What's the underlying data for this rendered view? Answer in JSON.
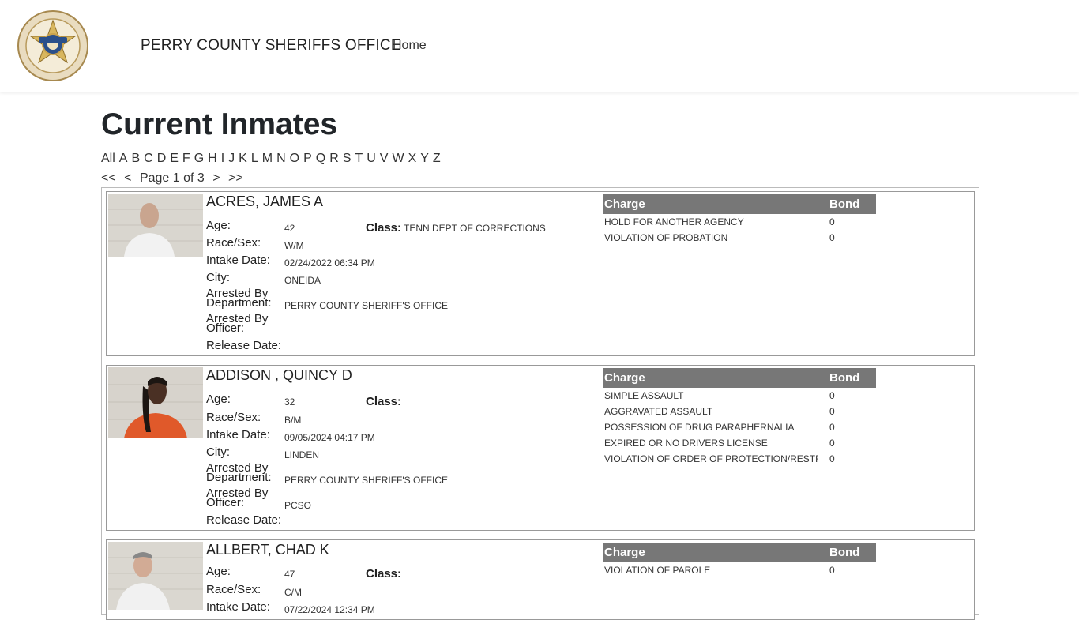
{
  "nav": {
    "brand": "PERRY COUNTY SHERIFFS OFFICE",
    "home": "Home"
  },
  "logo": {
    "top_text": "PERRY COUNTY",
    "bottom_text": "SHERIFFS OFFICE",
    "ribbon_text": "PROTECT"
  },
  "page_title": "Current Inmates",
  "alphabet": [
    "All",
    "A",
    "B",
    "C",
    "D",
    "E",
    "F",
    "G",
    "H",
    "I",
    "J",
    "K",
    "L",
    "M",
    "N",
    "O",
    "P",
    "Q",
    "R",
    "S",
    "T",
    "U",
    "V",
    "W",
    "X",
    "Y",
    "Z"
  ],
  "pager": {
    "first": "<<",
    "prev": "<",
    "label": "Page 1 of 3",
    "next": ">",
    "last": ">>"
  },
  "labels": {
    "age": "Age:",
    "race_sex": "Race/Sex:",
    "intake": "Intake Date:",
    "city": "City:",
    "arrested_dept_1": "Arrested By",
    "arrested_dept_2": "Department:",
    "arrested_off_1": "Arrested By",
    "arrested_off_2": "Officer:",
    "release": "Release Date:",
    "class": "Class:",
    "charge": "Charge",
    "bond": "Bond"
  },
  "inmates": [
    {
      "name": "ACRES, JAMES A",
      "age": "42",
      "class": "TENN DEPT OF CORRECTIONS",
      "race_sex": "W/M",
      "intake": "02/24/2022 06:34 PM",
      "city": "ONEIDA",
      "department": "PERRY COUNTY SHERIFF'S OFFICE",
      "officer": "",
      "release": "",
      "charges": [
        {
          "charge": "HOLD FOR ANOTHER AGENCY",
          "bond": "0"
        },
        {
          "charge": "VIOLATION OF PROBATION",
          "bond": "0"
        }
      ]
    },
    {
      "name": "ADDISON , QUINCY D",
      "age": "32",
      "class": "",
      "race_sex": "B/M",
      "intake": "09/05/2024 04:17 PM",
      "city": "LINDEN",
      "department": "PERRY COUNTY SHERIFF'S OFFICE",
      "officer": "PCSO",
      "release": "",
      "charges": [
        {
          "charge": "SIMPLE ASSAULT",
          "bond": "0"
        },
        {
          "charge": "AGGRAVATED ASSAULT",
          "bond": "0"
        },
        {
          "charge": "POSSESSION OF DRUG PARAPHERNALIA",
          "bond": "0"
        },
        {
          "charge": "EXPIRED OR NO DRIVERS LICENSE",
          "bond": "0"
        },
        {
          "charge": "VIOLATION OF ORDER OF PROTECTION/RESTRAI",
          "bond": "0"
        }
      ]
    },
    {
      "name": "ALLBERT, CHAD K",
      "age": "47",
      "class": "",
      "race_sex": "C/M",
      "intake": "07/22/2024 12:34 PM",
      "city": "",
      "department": "",
      "officer": "",
      "release": "",
      "charges": [
        {
          "charge": "VIOLATION OF PAROLE",
          "bond": "0"
        }
      ]
    }
  ]
}
